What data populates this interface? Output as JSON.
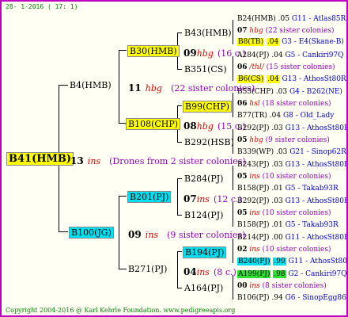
{
  "header": "28- 1-2016 ( 17: 1)",
  "footer": "Copyright 2004-2016 @ Karl Kehrle Foundation.   www.pedigreeapis.org",
  "root": {
    "name": "B41(HMB)",
    "gen": "13",
    "ins": "ins",
    "note": "(Drones from 2 sister colonies)"
  },
  "l1a": {
    "name": "B4(HMB)",
    "gen": "11",
    "ins": "hbg",
    "note": "(22 sister colonies)"
  },
  "l1b": {
    "name": "B100(JG)",
    "gen": "09",
    "ins": "ins",
    "note": "(9 sister colonies)"
  },
  "l2a": {
    "name": "B30(HMB)",
    "gen": "09",
    "ins": "hbg",
    "note": "(16 c.)"
  },
  "l2b": {
    "name": "B108(CHP)",
    "gen": "08",
    "ins": "hbg",
    "note": "(15 c.)"
  },
  "l2c": {
    "name": "B201(PJ)",
    "gen": "07",
    "ins": "ins",
    "note": "(12 c.)"
  },
  "l2d": {
    "name": "B271(PJ)",
    "gen": "04",
    "ins": "ins",
    "note": "(8 c.)"
  },
  "l3": {
    "a1": "B43(HMB)",
    "a2": "B351(CS)",
    "b1": "B99(CHP)",
    "b2": "B292(HSB)",
    "c1": "B284(PJ)",
    "c2": "B124(PJ)",
    "d1": "B194(PJ)",
    "d2": "A164(PJ)"
  },
  "l4": [
    {
      "name": "B24(HMB)",
      "val": ".05",
      "link": "G11 - Atlas85R"
    },
    {
      "gen": "07",
      "ins": "hbg",
      "note": "(22 sister colonies)"
    },
    {
      "name": "B8(TB)",
      "val": ".04",
      "link": "G3 - E4(Skane-B)"
    },
    {
      "name": "A284(PJ)",
      "val": ".04",
      "link": "G5 - Cankiri97Q"
    },
    {
      "gen": "06",
      "ins": "/thl/",
      "note": "(15 sister colonies)"
    },
    {
      "name": "B6(CS)",
      "val": ".04",
      "link": "G13 - AthosSt80R"
    },
    {
      "name": "B55(CHP)",
      "val": ".03",
      "link": "G4 - B262(NE)"
    },
    {
      "gen": "06",
      "ins": "hsl",
      "note": "(18 sister colonies)"
    },
    {
      "name": "B77(TR)",
      "val": ".04",
      "link": "G8 - Old_Lady"
    },
    {
      "name": "B292(PJ)",
      "val": ".03",
      "link": "G13 - AthosSt80R"
    },
    {
      "gen": "05",
      "ins": "hbg",
      "note": "(9 sister colonies)"
    },
    {
      "name": "B339(WP)",
      "val": ".03",
      "link": "G21 - Sinop62R"
    },
    {
      "name": "B243(PJ)",
      "val": ".03",
      "link": "G13 - AthosSt80R"
    },
    {
      "gen": "05",
      "ins": "ins",
      "note": "(10 sister colonies)"
    },
    {
      "name": "B158(PJ)",
      "val": ".01",
      "link": "G5 - Takab93R"
    },
    {
      "name": "B292(PJ)",
      "val": ".03",
      "link": "G13 - AthosSt80R"
    },
    {
      "gen": "05",
      "ins": "ins",
      "note": "(10 sister colonies)"
    },
    {
      "name": "B158(PJ)",
      "val": ".01",
      "link": "G5 - Takab93R"
    },
    {
      "name": "B214(PJ)",
      "val": ".00",
      "link": "G11 - AthosSt80R"
    },
    {
      "gen": "02",
      "ins": "ins",
      "note": "(10 sister colonies)"
    },
    {
      "name": "B240(PJ)",
      "val": ".99",
      "link": "G11 - AthosSt80R"
    },
    {
      "name": "A199(PJ)",
      "val": ".98",
      "link": "G2 - Cankiri97Q"
    },
    {
      "gen": "00",
      "ins": "ins",
      "note": "(8 sister colonies)"
    },
    {
      "name": "B106(PJ)",
      "val": ".94",
      "link": "G6 - SinopEgg86R"
    }
  ]
}
